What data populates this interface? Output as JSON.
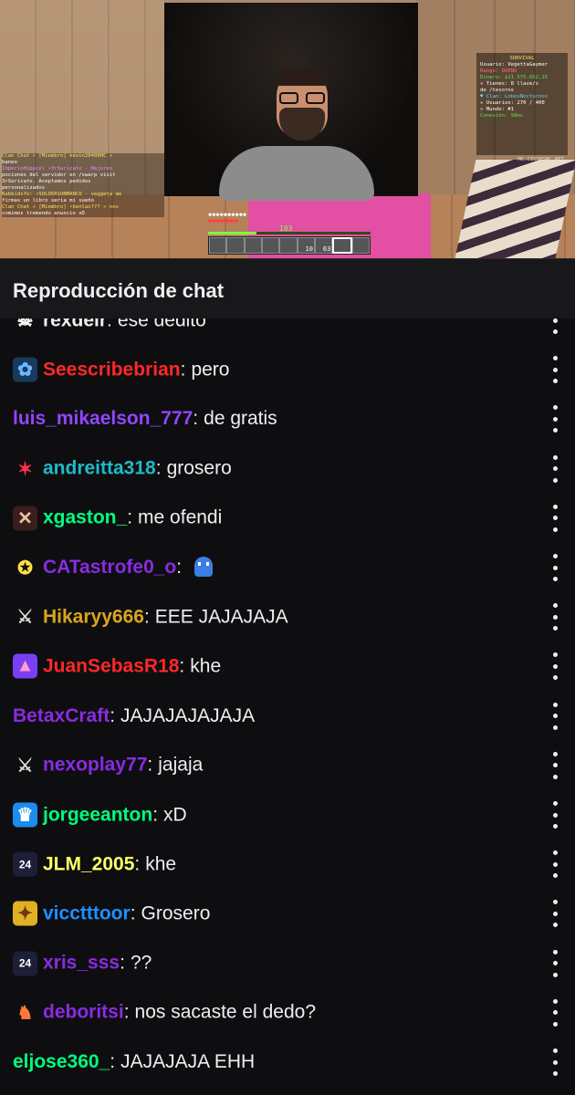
{
  "stream": {
    "scoreboard": {
      "title": "SURVIVAL",
      "lines": [
        "Usuario: VegettaGaymer",
        "Rango: DUEÑO",
        "Dinero: $11.575.852,15",
        "» Tienes: 8 llave/s",
        "de /tesoros",
        "♥ Clan: LobosNocturnos",
        "» Usuarios: 270 / 400",
        "» Mundo: #1",
        "Conexión: 98ms"
      ],
      "footer": "MC.CIOSESMC.NET"
    },
    "game_chat": [
      "Clan Chat » [Miembro] kevin20400HC »",
      "baneo",
      "ImperioHippie) ⚡3rSuricato - Mejores",
      "pociones del servidor en /swarp visit",
      "3rSuricato. Aceptamos pedidos",
      "personalizados",
      "Rabbidsfo: ⚡SOLO501UNMANCO - veggeta me",
      "firmas un libro seria mi sueño",
      "Clan Chat » [Miembro] ⚡kenlax??? » nos",
      "comimos tremendo anuncio xD"
    ],
    "xp_level": "103",
    "hotbar_counts": [
      "",
      "",
      "",
      "",
      "",
      "10",
      "63",
      "",
      ""
    ]
  },
  "header": {
    "title": "Reproducción de chat"
  },
  "colors": {
    "background": "#0e0e10",
    "header_bg": "#18181b",
    "text": "#efeff1"
  },
  "messages": [
    {
      "badge": "skull",
      "user": "rexdeir",
      "color": "#efeff1",
      "text": "ese dedito"
    },
    {
      "badge": "blue-flower",
      "user": "Seescribebrian",
      "color": "#ff2828",
      "text": "pero"
    },
    {
      "badge": "",
      "user": "luis_mikaelson_777",
      "color": "#9146ff",
      "text": "de gratis"
    },
    {
      "badge": "red-sparkle",
      "user": "andreitta318",
      "color": "#1fb9c9",
      "text": "grosero"
    },
    {
      "badge": "crossed-x",
      "user": "xgaston_",
      "color": "#00ff7f",
      "text": "me ofendi"
    },
    {
      "badge": "pichu",
      "user": "CATastrofe0_o",
      "color": "#8a2be2",
      "text": "",
      "emote": "blue-ghost"
    },
    {
      "badge": "crossed-swords",
      "user": "Hikaryy666",
      "color": "#daa520",
      "text": "EEE JAJAJAJA"
    },
    {
      "badge": "cake",
      "user": "JuanSebasR18",
      "color": "#ff2828",
      "text": "khe"
    },
    {
      "badge": "",
      "user": "BetaxCraft",
      "color": "#8a2be2",
      "text": "JAJAJAJAJAJA"
    },
    {
      "badge": "crossed-swords",
      "user": "nexoplay77",
      "color": "#8a2be2",
      "text": "jajaja"
    },
    {
      "badge": "crown",
      "user": "jorgeeanton",
      "color": "#00ff7f",
      "text": "xD"
    },
    {
      "badge": "year-24",
      "user": "JLM_2005",
      "color": "#ffff66",
      "text": "khe"
    },
    {
      "badge": "dog",
      "user": "vicctttoor",
      "color": "#1e90ff",
      "text": "Grosero"
    },
    {
      "badge": "year-24",
      "user": "xris_sss",
      "color": "#8a2be2",
      "text": "??"
    },
    {
      "badge": "unicorn",
      "user": "deboritsi",
      "color": "#8a2be2",
      "text": "nos sacaste el dedo?"
    },
    {
      "badge": "",
      "user": "eljose360_",
      "color": "#00ff7f",
      "text": "JAJAJAJA EHH"
    }
  ]
}
